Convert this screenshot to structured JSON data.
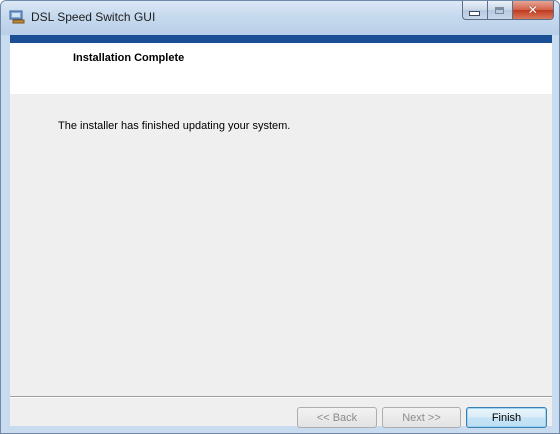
{
  "window": {
    "title": "DSL Speed Switch GUI",
    "icon": "installer-app-icon"
  },
  "caption_buttons": {
    "minimize_icon": "minimize-icon",
    "maximize_icon": "maximize-icon",
    "close_icon": "close-icon"
  },
  "banner": {
    "title": "Installation Complete"
  },
  "content": {
    "message": "The installer has finished updating your system."
  },
  "footer": {
    "back_label": "<< Back",
    "next_label": "Next >>",
    "finish_label": "Finish"
  },
  "colors": {
    "accent_bar": "#1b4f95",
    "client_bg": "#efefef",
    "close_button": "#c0391f"
  }
}
